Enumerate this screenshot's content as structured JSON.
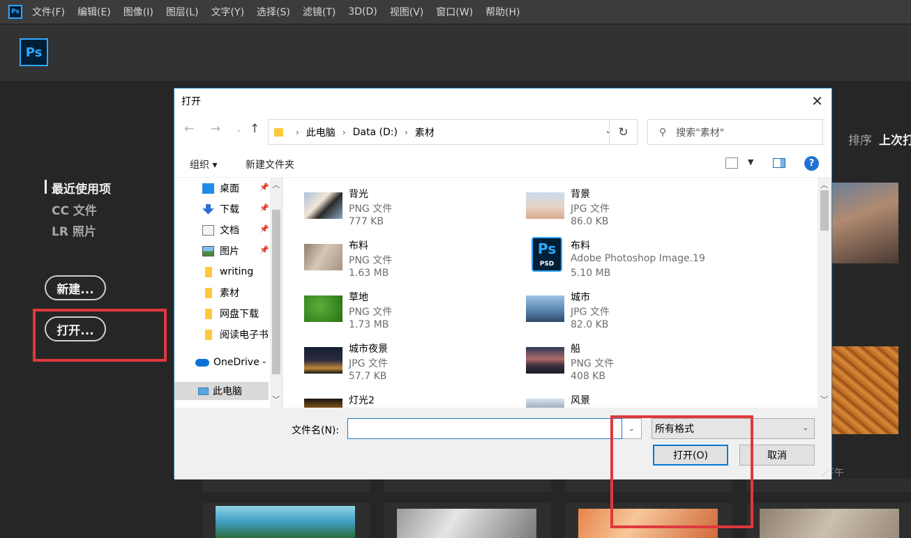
{
  "menubar": {
    "logo": "Ps",
    "items": [
      "文件(F)",
      "编辑(E)",
      "图像(I)",
      "图层(L)",
      "文字(Y)",
      "选择(S)",
      "滤镜(T)",
      "3D(D)",
      "视图(V)",
      "窗口(W)",
      "帮助(H)"
    ]
  },
  "home": {
    "logo": "Ps",
    "nav": [
      "最近使用项",
      "CC 文件",
      "LR 照片"
    ],
    "new_button": "新建...",
    "open_button": "打开...",
    "sort_label": "排序",
    "sort_value": "上次打",
    "time_fragment": "下午"
  },
  "dialog": {
    "title": "打开",
    "breadcrumb": [
      "此电脑",
      "Data (D:)",
      "素材"
    ],
    "search_placeholder": "搜索\"素材\"",
    "toolbar": {
      "organize": "组织 ▾",
      "new_folder": "新建文件夹",
      "help": "?"
    },
    "nav_pane": [
      {
        "label": "桌面",
        "icon": "desktop-icon",
        "pinned": true
      },
      {
        "label": "下载",
        "icon": "download-icon",
        "pinned": true
      },
      {
        "label": "文档",
        "icon": "document-icon",
        "pinned": true
      },
      {
        "label": "图片",
        "icon": "pictures-icon",
        "pinned": true
      },
      {
        "label": "writing",
        "icon": "folder-icon",
        "pinned": false
      },
      {
        "label": "素材",
        "icon": "folder-icon",
        "pinned": false
      },
      {
        "label": "网盘下载",
        "icon": "folder-icon",
        "pinned": false
      },
      {
        "label": "阅读电子书",
        "icon": "folder-icon",
        "pinned": false
      },
      {
        "label": "OneDrive -",
        "icon": "onedrive-icon",
        "pinned": false
      },
      {
        "label": "此电脑",
        "icon": "computer-icon",
        "pinned": false
      }
    ],
    "files": [
      {
        "name": "背光",
        "type": "PNG 文件",
        "size": "777 KB"
      },
      {
        "name": "背景",
        "type": "JPG 文件",
        "size": "86.0 KB"
      },
      {
        "name": "布料",
        "type": "PNG 文件",
        "size": "1.63 MB"
      },
      {
        "name": "布料",
        "type": "Adobe Photoshop Image.19",
        "size": "5.10 MB"
      },
      {
        "name": "草地",
        "type": "PNG 文件",
        "size": "1.73 MB"
      },
      {
        "name": "城市",
        "type": "JPG 文件",
        "size": "82.0 KB"
      },
      {
        "name": "城市夜景",
        "type": "JPG 文件",
        "size": "57.7 KB"
      },
      {
        "name": "船",
        "type": "PNG 文件",
        "size": "408 KB"
      },
      {
        "name": "灯光2",
        "type": "",
        "size": ""
      },
      {
        "name": "风景",
        "type": "",
        "size": ""
      }
    ],
    "psd_icon": {
      "big": "Ps",
      "small": "PSD"
    },
    "filename_label": "文件名(N):",
    "filename_value": "",
    "format_value": "所有格式",
    "open_button": "打开(O)",
    "cancel_button": "取消"
  },
  "colors": {
    "ps_blue": "#31a8ff",
    "ps_navy": "#001e36",
    "highlight_red": "#e0383e",
    "dialog_border": "#1f86c4"
  }
}
